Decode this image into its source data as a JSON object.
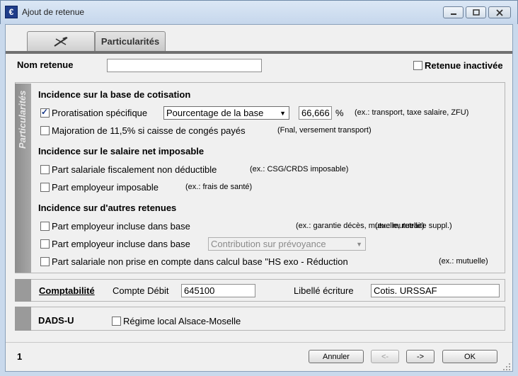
{
  "window": {
    "title": "Ajout de retenue",
    "app_icon_glyph": "€"
  },
  "tabs": [
    {
      "label": "",
      "icon": "tools-icon"
    },
    {
      "label": "Particularités"
    }
  ],
  "header": {
    "nom_label": "Nom retenue",
    "nom_value": "",
    "inactive_label": "Retenue inactivée",
    "inactive_checked": false
  },
  "particularites": {
    "side_label": "Particularités",
    "base_title": "Incidence sur la base de cotisation",
    "proratisation_label": "Proratisation spécifique",
    "proratisation_checked": true,
    "proratisation_select": "Pourcentage de la base",
    "proratisation_value": "66,666",
    "percent_sign": "%",
    "proratisation_hint": "(ex.: transport, taxe salaire, ZFU)",
    "majoration_label": "Majoration de 11,5% si caisse de congés payés",
    "majoration_hint": "(Fnal, versement transport)",
    "net_title": "Incidence sur le salaire net imposable",
    "part_sal_label": "Part salariale fiscalement non déductible",
    "part_sal_hint": "(ex.: CSG/CRDS imposable)",
    "part_emp_label": "Part employeur imposable",
    "part_emp_hint": "(ex.: frais de santé)",
    "autres_title": "Incidence sur d'autres retenues",
    "emp_incl1_label": "Part employeur incluse dans base",
    "emp_incl1_hint_a": "(ex.: garantie décès, mutuelle, retraite suppl.)",
    "emp_incl1_hint_b": "(ex.: mutuelle)",
    "emp_incl2_label": "Part employeur incluse dans base",
    "emp_incl2_select": "Contribution sur prévoyance",
    "sal_non_prise_label": "Part salariale non prise en compte dans calcul base \"HS exo - Réduction",
    "sal_non_prise_hint": "(ex.: mutuelle)"
  },
  "comptabilite": {
    "title": "Comptabilité",
    "compte_label": "Compte Débit",
    "compte_value": "645100",
    "libelle_label": "Libellé écriture",
    "libelle_value": "Cotis. URSSAF"
  },
  "dadsu": {
    "title": "DADS-U",
    "regime_label": "Régime local Alsace-Moselle",
    "regime_checked": false
  },
  "footer": {
    "page_number": "1",
    "annuler": "Annuler",
    "prev": "<-",
    "next": "->",
    "ok": "OK"
  }
}
